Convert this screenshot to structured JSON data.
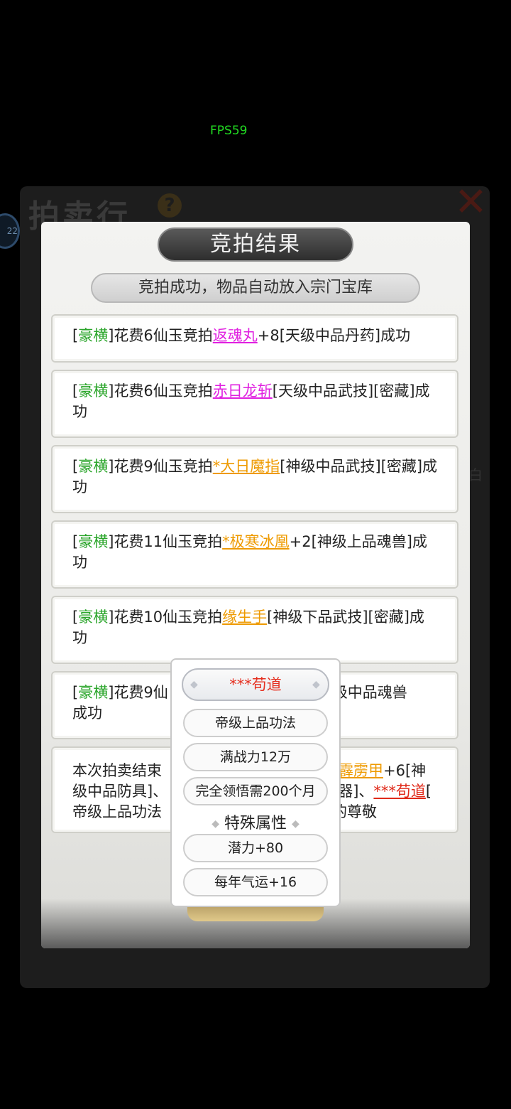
{
  "fps": {
    "label": "FPS59",
    "color": "#22dd22"
  },
  "background": {
    "title": "拍卖行",
    "help_icon": "question-icon",
    "help_glyph": "?",
    "close_icon": "close-icon",
    "avatar_badge": "22",
    "edge_char": "白"
  },
  "panel": {
    "title": "竞拍结果",
    "subtitle": "竞拍成功，物品自动放入宗门宝库"
  },
  "entries": [
    {
      "bidder": "豪横",
      "spent": "]花费6仙玉竞拍",
      "item": "返魂丸",
      "rest": "+8[天级中品丹药]成功",
      "item_color": "#e020e0"
    },
    {
      "bidder": "豪横",
      "spent": "]花费6仙玉竞拍",
      "item": "赤日龙斩",
      "rest": "[天级中品武技][密藏]成功",
      "item_color": "#e020e0"
    },
    {
      "bidder": "豪横",
      "spent": "]花费9仙玉竞拍",
      "item": "*大日魔指",
      "rest": "[神级中品武技][密藏]成功",
      "item_color": "#ee9a00"
    },
    {
      "bidder": "豪横",
      "spent": "]花费11仙玉竞拍",
      "item": "*极寒冰凰",
      "rest": "+2[神级上品魂兽]成功",
      "item_color": "#ee9a00"
    },
    {
      "bidder": "豪横",
      "spent": "]花费10仙玉竞拍",
      "item": "缘生手",
      "rest": "[神级下品武技][密藏]成功",
      "item_color": "#ee9a00"
    },
    {
      "bidder": "豪横",
      "spent": "]花费9仙",
      "rest_right": "级中品魂兽",
      "tail": "成功"
    }
  ],
  "summary": {
    "p1": "本次拍卖结束",
    "item1": "电霹雳甲",
    "p2": "+6[神",
    "p3": "级中品防具]、",
    "p4": "器]、",
    "item2": "***苟道",
    "p5": "[",
    "p6": "帝级上品功法",
    "p7": "的尊敬"
  },
  "tooltip": {
    "name": "***苟道",
    "grade": "帝级上品功法",
    "power": "满战力12万",
    "mastery": "完全领悟需200个月",
    "special_title": "特殊属性",
    "attr1": "潜力+80",
    "attr2": "每年气运+16"
  }
}
